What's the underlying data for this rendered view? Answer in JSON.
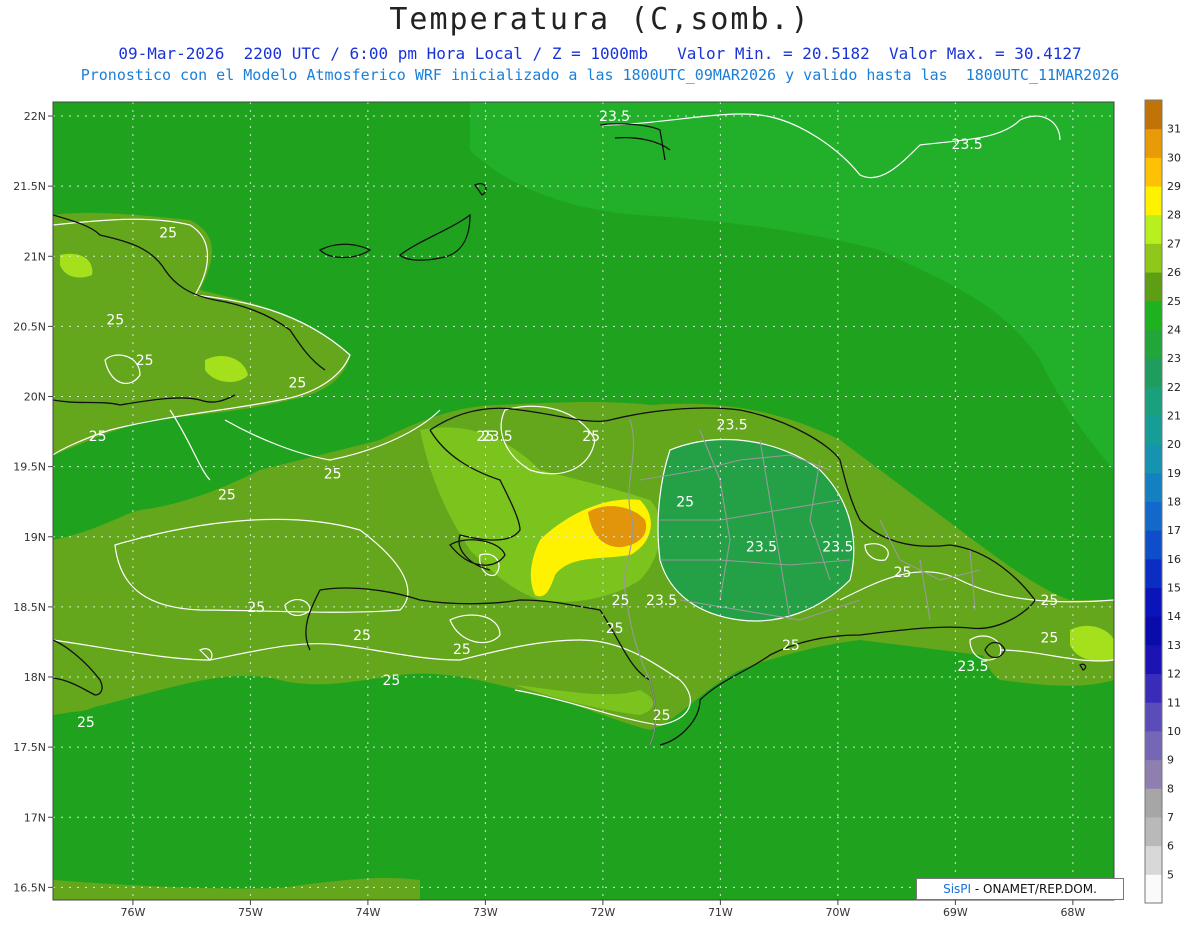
{
  "title": "Temperatura (C,somb.)",
  "subtitle_line1": "09-Mar-2026  2200 UTC / 6:00 pm Hora Local / Z = 1000mb   Valor Min. = 20.5182  Valor Max. = 30.4127",
  "subtitle_line2": "Pronostico con el Modelo Atmosferico WRF inicializado a las 1800UTC_09MAR2026 y valido hasta las  1800UTC_11MAR2026",
  "credit": {
    "brand": "SisPI",
    "text": " - ONAMET/REP.DOM."
  },
  "axes": {
    "lat_labels": [
      "22N",
      "21.5N",
      "21N",
      "20.5N",
      "20N",
      "19.5N",
      "19N",
      "18.5N",
      "18N",
      "17.5N",
      "17N",
      "16.5N"
    ],
    "lon_labels": [
      "76W",
      "75W",
      "74W",
      "73W",
      "72W",
      "71W",
      "70W",
      "69W",
      "68W"
    ]
  },
  "colors": {
    "background_field": "#1fa31f",
    "northeast_field": "#22b02a",
    "land_25": "#64a61c",
    "land_26": "#7bc31d",
    "land_27": "#a4e01b",
    "land_28": "#fff200",
    "land_30": "#e2940a",
    "land_23": "#24a046",
    "contour": "#ffffff",
    "coast": "#111111",
    "border": "#999999"
  },
  "contour_labels": [
    {
      "text": "23.5",
      "lon": -71.9,
      "lat": 22.0
    },
    {
      "text": "23.5",
      "lon": -68.9,
      "lat": 21.8
    },
    {
      "text": "25",
      "lon": -75.7,
      "lat": 21.17
    },
    {
      "text": "25",
      "lon": -76.15,
      "lat": 20.55
    },
    {
      "text": "25",
      "lon": -75.9,
      "lat": 20.26
    },
    {
      "text": "25",
      "lon": -74.6,
      "lat": 20.1
    },
    {
      "text": "25",
      "lon": -76.3,
      "lat": 19.72
    },
    {
      "text": "25",
      "lon": -73.0,
      "lat": 19.72
    },
    {
      "text": "23.5",
      "lon": -72.9,
      "lat": 19.72
    },
    {
      "text": "25",
      "lon": -72.1,
      "lat": 19.72
    },
    {
      "text": "23.5",
      "lon": -70.9,
      "lat": 19.8
    },
    {
      "text": "25",
      "lon": -74.3,
      "lat": 19.45
    },
    {
      "text": "25",
      "lon": -75.2,
      "lat": 19.3
    },
    {
      "text": "25",
      "lon": -71.3,
      "lat": 19.25
    },
    {
      "text": "23.5",
      "lon": -70.65,
      "lat": 18.93
    },
    {
      "text": "23.5",
      "lon": -70.0,
      "lat": 18.93
    },
    {
      "text": "25",
      "lon": -69.45,
      "lat": 18.75
    },
    {
      "text": "25",
      "lon": -74.95,
      "lat": 18.5
    },
    {
      "text": "25",
      "lon": -71.85,
      "lat": 18.55
    },
    {
      "text": "23.5",
      "lon": -71.5,
      "lat": 18.55
    },
    {
      "text": "25",
      "lon": -68.2,
      "lat": 18.55
    },
    {
      "text": "25",
      "lon": -74.05,
      "lat": 18.3
    },
    {
      "text": "25",
      "lon": -71.9,
      "lat": 18.35
    },
    {
      "text": "25",
      "lon": -68.2,
      "lat": 18.28
    },
    {
      "text": "25",
      "lon": -73.2,
      "lat": 18.2
    },
    {
      "text": "25",
      "lon": -70.4,
      "lat": 18.23
    },
    {
      "text": "23.5",
      "lon": -68.85,
      "lat": 18.08
    },
    {
      "text": "25",
      "lon": -73.8,
      "lat": 17.98
    },
    {
      "text": "25",
      "lon": -71.5,
      "lat": 17.73
    },
    {
      "text": "25",
      "lon": -76.4,
      "lat": 17.68
    }
  ],
  "colorbar": {
    "labels": [
      "5",
      "6",
      "7",
      "8",
      "9",
      "10",
      "11",
      "12",
      "13",
      "14",
      "15",
      "16",
      "17",
      "18",
      "19",
      "20",
      "21",
      "22",
      "23",
      "24",
      "25",
      "26",
      "27",
      "28",
      "29",
      "30",
      "31"
    ],
    "colors": [
      "#fafafa",
      "#d8d8d8",
      "#b9b9b9",
      "#a6a6a6",
      "#8e7fb0",
      "#7667b6",
      "#5b4db9",
      "#3a2cb8",
      "#1c14b2",
      "#0a0bab",
      "#0a14b8",
      "#0b2dc4",
      "#0f4ecb",
      "#1269c9",
      "#1280c1",
      "#1693b0",
      "#179c98",
      "#1aa07d",
      "#1f9d5e",
      "#22a63a",
      "#1fb21f",
      "#5e9e12",
      "#8fc81b",
      "#b8ef1e",
      "#fff200",
      "#ffc106",
      "#e89a07",
      "#c07408"
    ]
  }
}
